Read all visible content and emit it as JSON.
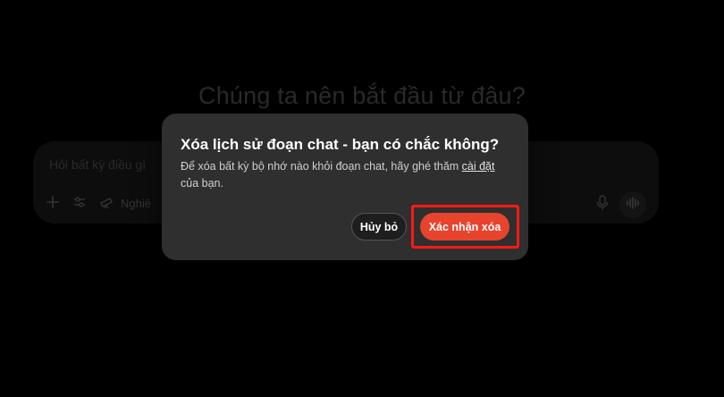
{
  "background": {
    "heading": "Chúng ta nên bắt đầu từ đâu?",
    "composer": {
      "placeholder": "Hỏi bất kỳ điều gì",
      "tool_label": "Nghiê"
    }
  },
  "dialog": {
    "title": "Xóa lịch sử đoạn chat - bạn có chắc không?",
    "description_before_link": "Để xóa bất kỳ bộ nhớ nào khỏi đoạn chat, hãy ghé thăm ",
    "link_text": "cài đặt",
    "description_after_link": " của bạn.",
    "cancel_label": "Hủy bỏ",
    "confirm_label": "Xác nhận xóa"
  },
  "colors": {
    "confirm_button": "#e8432d",
    "highlight_border": "#ff1a12",
    "dialog_background": "#2f2f2f"
  }
}
